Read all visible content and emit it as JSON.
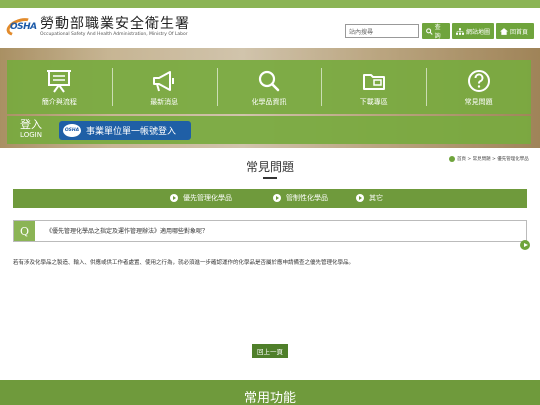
{
  "header": {
    "site_name_zh": "勞動部職業安全衛生署",
    "site_name_en": "Occupational Safety And Health Administration, Ministry Of Labor",
    "logo_text": "OSHA",
    "search_placeholder": "站內搜尋",
    "search_button": "查詢",
    "sitemap_button": "網站地圖",
    "home_button": "回首頁"
  },
  "nav": {
    "items": [
      {
        "label": "簡介與流程",
        "icon": "presentation-board-icon"
      },
      {
        "label": "最新消息",
        "icon": "megaphone-icon"
      },
      {
        "label": "化學品資訊",
        "icon": "magnifier-icon"
      },
      {
        "label": "下載專區",
        "icon": "download-folder-icon"
      },
      {
        "label": "常見問題",
        "icon": "question-icon"
      }
    ]
  },
  "login": {
    "label_zh": "登入",
    "label_en": "LOGIN",
    "button_label": "事業單位單一帳號登入",
    "badge_text": "OSHA"
  },
  "main": {
    "title": "常見問題",
    "breadcrumb": "首頁 > 常見問題 > 優先管理化學品",
    "tabs": [
      "優先管理化學品",
      "管制性化學品",
      "其它"
    ],
    "question_mark": "Q",
    "question": "《優先管理化學品之指定及運作管理辦法》適用哪些對象呢？",
    "answer": "若有涉及化學品之製造、輸入、供應或供工作者處置、使用之行為，就必須進一步確認運作的化學品是否屬於應申請備查之優先管理化學品。",
    "back_to_top": "回上一頁"
  },
  "footer": {
    "title": "常用功能"
  },
  "colors": {
    "brand_green": "#79aa40",
    "dark_green": "#6f9a3c",
    "login_blue": "#1f5fa6",
    "logo_orange": "#e28b2c"
  }
}
